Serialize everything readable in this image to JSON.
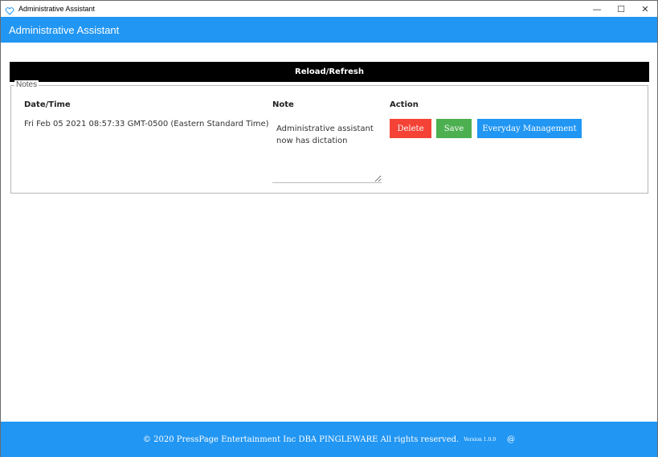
{
  "window": {
    "title": "Administrative Assistant",
    "controls": {
      "minimize": "—",
      "maximize": "☐",
      "close": "✕"
    }
  },
  "appbar": {
    "title": "Administrative Assistant"
  },
  "toolbar": {
    "reload_label": "Reload/Refresh"
  },
  "notes": {
    "legend": "Notes",
    "columns": {
      "datetime": "Date/Time",
      "note": "Note",
      "action": "Action"
    },
    "rows": [
      {
        "datetime": "Fri Feb 05 2021 08:57:33 GMT-0500 (Eastern Standard Time)",
        "note": "Administrative assistant now has dictation",
        "actions": {
          "delete": "Delete",
          "save": "Save",
          "manage": "Everyday Management"
        }
      }
    ]
  },
  "footer": {
    "copyright": "© 2020 PressPage Entertainment Inc DBA PINGLEWARE  All rights reserved.",
    "version": "Version 1.0.0",
    "at": "@"
  },
  "colors": {
    "primary": "#2196f3",
    "danger": "#f44336",
    "success": "#4caf50",
    "toolbar_bg": "#000000"
  }
}
